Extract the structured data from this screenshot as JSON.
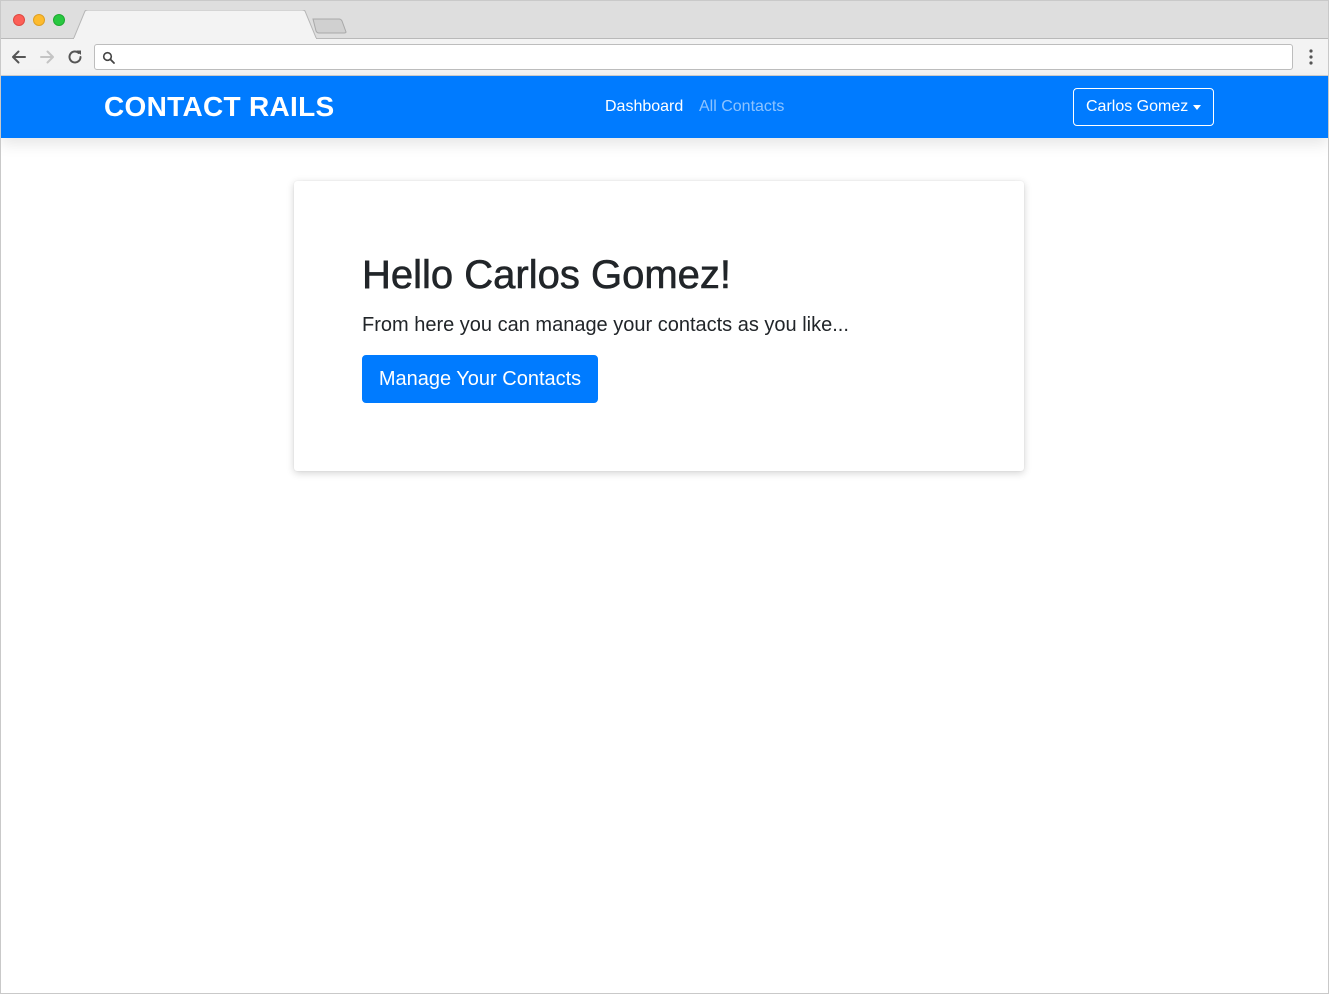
{
  "browser": {
    "tab_title": "",
    "address_bar": {
      "value": "",
      "placeholder": ""
    },
    "icons": {
      "back": "back-arrow-icon",
      "forward": "forward-arrow-icon",
      "reload": "reload-icon",
      "search": "search-icon",
      "menu": "more-vertical-icon"
    }
  },
  "navbar": {
    "brand": "CONTACT RAILS",
    "links": [
      {
        "label": "Dashboard",
        "active": true
      },
      {
        "label": "All Contacts",
        "active": false
      }
    ],
    "user_menu": {
      "label": "Carlos Gomez",
      "icon": "caret-down-icon"
    }
  },
  "main": {
    "heading": "Hello Carlos Gomez!",
    "lead": "From here you can manage your contacts as you like...",
    "cta_label": "Manage Your Contacts"
  },
  "colors": {
    "primary": "#007bff",
    "text": "#212529",
    "nav_inactive": "rgba(255,255,255,0.55)",
    "chrome": "#dedede"
  }
}
